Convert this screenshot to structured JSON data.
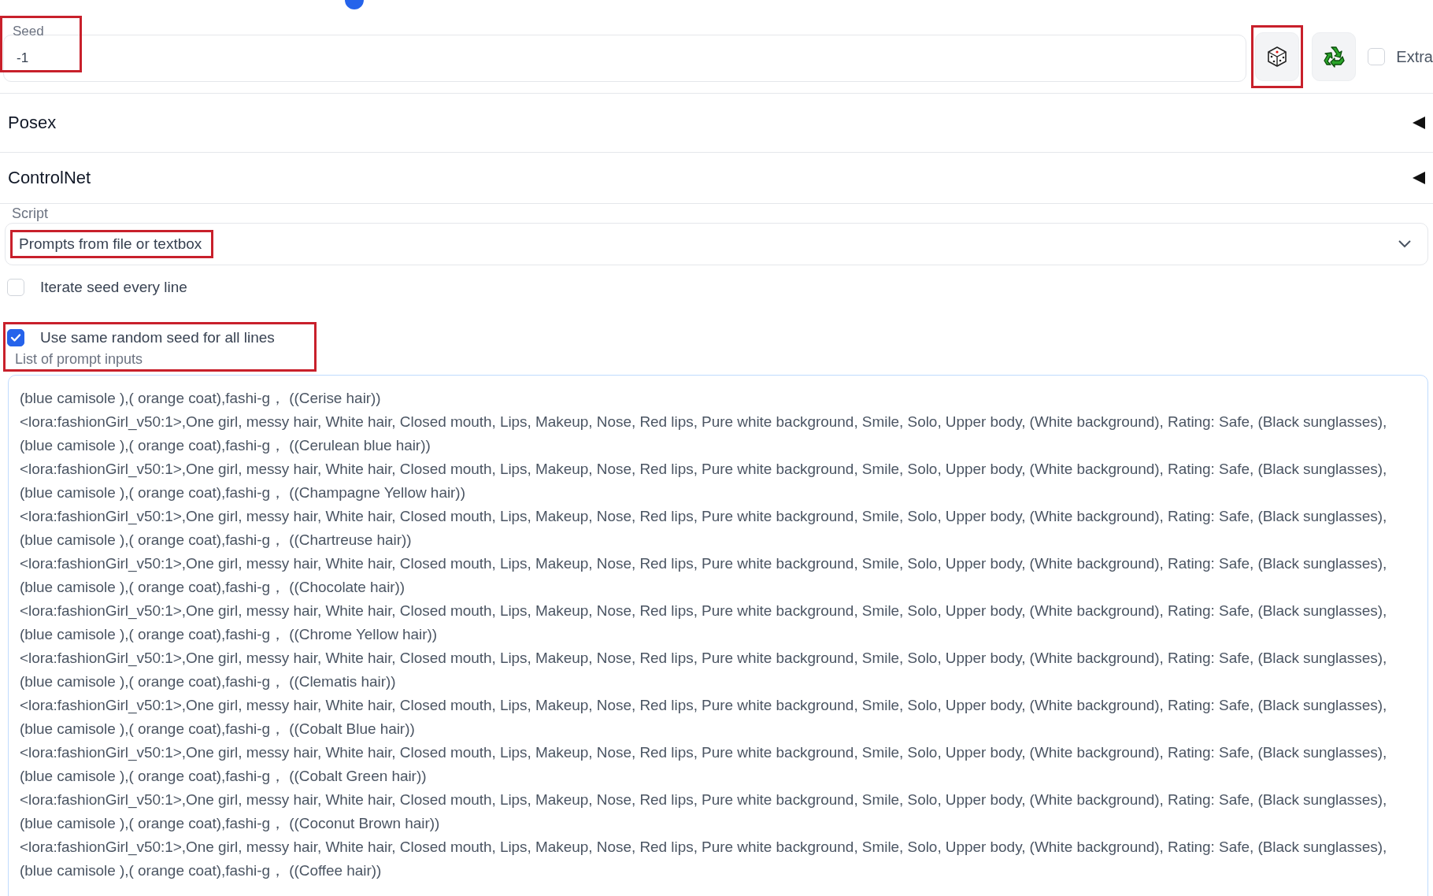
{
  "seed": {
    "label": "Seed",
    "value": "-1",
    "highlighted": true
  },
  "seed_buttons": [
    {
      "kind": "dice",
      "highlighted": true
    },
    {
      "kind": "recycle",
      "highlighted": false
    }
  ],
  "extra_checkbox": {
    "label": "Extra",
    "checked": false
  },
  "accordions": [
    {
      "title": "Posex",
      "expanded": false
    },
    {
      "title": "ControlNet",
      "expanded": false
    }
  ],
  "script": {
    "label": "Script",
    "value": "Prompts from file or textbox",
    "highlighted": true
  },
  "options": [
    {
      "label": "Iterate seed every line",
      "checked": false,
      "highlighted": false
    },
    {
      "label": "Use same random seed for all lines",
      "checked": true,
      "highlighted": true
    }
  ],
  "prompt_inputs": {
    "label": "List of prompt inputs",
    "lines": [
      "(blue camisole ),( orange coat),fashi-g， ((Cerise hair))",
      "<lora:fashionGirl_v50:1>,One girl, messy hair, White hair, Closed mouth, Lips, Makeup, Nose, Red lips, Pure white background, Smile, Solo, Upper body, (White background), Rating: Safe, (Black sunglasses),",
      "(blue camisole ),( orange coat),fashi-g， ((Cerulean blue hair))",
      "<lora:fashionGirl_v50:1>,One girl, messy hair, White hair, Closed mouth, Lips, Makeup, Nose, Red lips, Pure white background, Smile, Solo, Upper body, (White background), Rating: Safe, (Black sunglasses),",
      "(blue camisole ),( orange coat),fashi-g， ((Champagne Yellow hair))",
      "<lora:fashionGirl_v50:1>,One girl, messy hair, White hair, Closed mouth, Lips, Makeup, Nose, Red lips, Pure white background, Smile, Solo, Upper body, (White background), Rating: Safe, (Black sunglasses),",
      "(blue camisole ),( orange coat),fashi-g， ((Chartreuse hair))",
      "<lora:fashionGirl_v50:1>,One girl, messy hair, White hair, Closed mouth, Lips, Makeup, Nose, Red lips, Pure white background, Smile, Solo, Upper body, (White background), Rating: Safe, (Black sunglasses),",
      "(blue camisole ),( orange coat),fashi-g， ((Chocolate hair))",
      "<lora:fashionGirl_v50:1>,One girl, messy hair, White hair, Closed mouth, Lips, Makeup, Nose, Red lips, Pure white background, Smile, Solo, Upper body, (White background), Rating: Safe, (Black sunglasses),",
      "(blue camisole ),( orange coat),fashi-g， ((Chrome Yellow hair))",
      "<lora:fashionGirl_v50:1>,One girl, messy hair, White hair, Closed mouth, Lips, Makeup, Nose, Red lips, Pure white background, Smile, Solo, Upper body, (White background), Rating: Safe, (Black sunglasses),",
      "(blue camisole ),( orange coat),fashi-g， ((Clematis hair))",
      "<lora:fashionGirl_v50:1>,One girl, messy hair, White hair, Closed mouth, Lips, Makeup, Nose, Red lips, Pure white background, Smile, Solo, Upper body, (White background), Rating: Safe, (Black sunglasses),",
      "(blue camisole ),( orange coat),fashi-g， ((Cobalt Blue hair))",
      "<lora:fashionGirl_v50:1>,One girl, messy hair, White hair, Closed mouth, Lips, Makeup, Nose, Red lips, Pure white background, Smile, Solo, Upper body, (White background), Rating: Safe, (Black sunglasses),",
      "(blue camisole ),( orange coat),fashi-g， ((Cobalt Green hair))",
      "<lora:fashionGirl_v50:1>,One girl, messy hair, White hair, Closed mouth, Lips, Makeup, Nose, Red lips, Pure white background, Smile, Solo, Upper body, (White background), Rating: Safe, (Black sunglasses),",
      "(blue camisole ),( orange coat),fashi-g， ((Coconut Brown hair))",
      "<lora:fashionGirl_v50:1>,One girl, messy hair, White hair, Closed mouth, Lips, Makeup, Nose, Red lips, Pure white background, Smile, Solo, Upper body, (White background), Rating: Safe, (Black sunglasses),",
      "(blue camisole ),( orange coat),fashi-g， ((Coffee hair))"
    ]
  }
}
